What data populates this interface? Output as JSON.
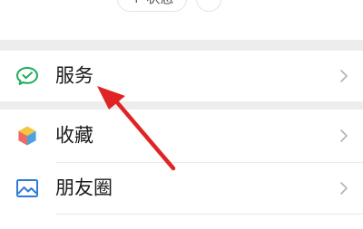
{
  "header": {
    "status_button_label": "+ 状态",
    "more_button_label": "···"
  },
  "menu": {
    "services": {
      "label": "服务",
      "icon": "wechat-pay-icon",
      "accent": "#1aad5b"
    },
    "favorites": {
      "label": "收藏",
      "icon": "cube-icon"
    },
    "moments": {
      "label": "朋友圈",
      "icon": "landscape-picture-icon",
      "accent": "#2f7bd8"
    }
  },
  "annotation": {
    "arrow_color": "#e02424",
    "points_to": "服务"
  },
  "colors": {
    "background_gap": "#ededed",
    "chevron": "#b2b2b2"
  }
}
